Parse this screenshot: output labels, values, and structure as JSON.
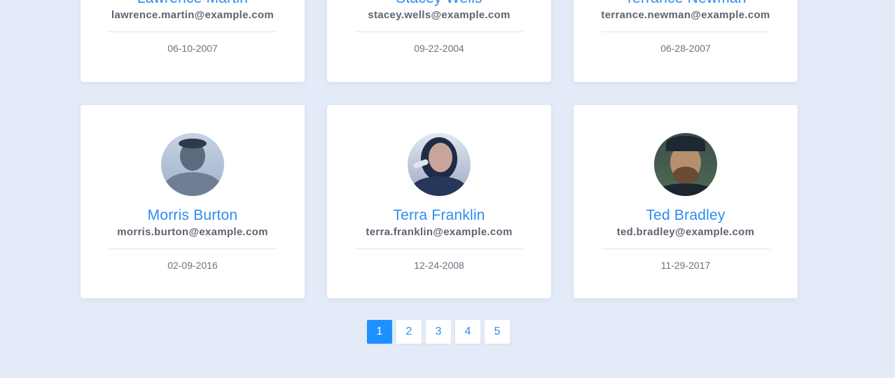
{
  "cards_top": [
    {
      "name": "Lawrence Martin",
      "email": "lawrence.martin@example.com",
      "date": "06-10-2007"
    },
    {
      "name": "Stacey Wells",
      "email": "stacey.wells@example.com",
      "date": "09-22-2004"
    },
    {
      "name": "Terrance Newman",
      "email": "terrance.newman@example.com",
      "date": "06-28-2007"
    }
  ],
  "cards_bottom": [
    {
      "name": "Morris Burton",
      "email": "morris.burton@example.com",
      "date": "02-09-2016"
    },
    {
      "name": "Terra Franklin",
      "email": "terra.franklin@example.com",
      "date": "12-24-2008"
    },
    {
      "name": "Ted Bradley",
      "email": "ted.bradley@example.com",
      "date": "11-29-2017"
    }
  ],
  "pagination": {
    "pages": [
      "1",
      "2",
      "3",
      "4",
      "5"
    ],
    "active": "1"
  },
  "colors": {
    "background": "#e3ebf8",
    "accent": "#2d8cf0",
    "active_page": "#1e90ff"
  }
}
